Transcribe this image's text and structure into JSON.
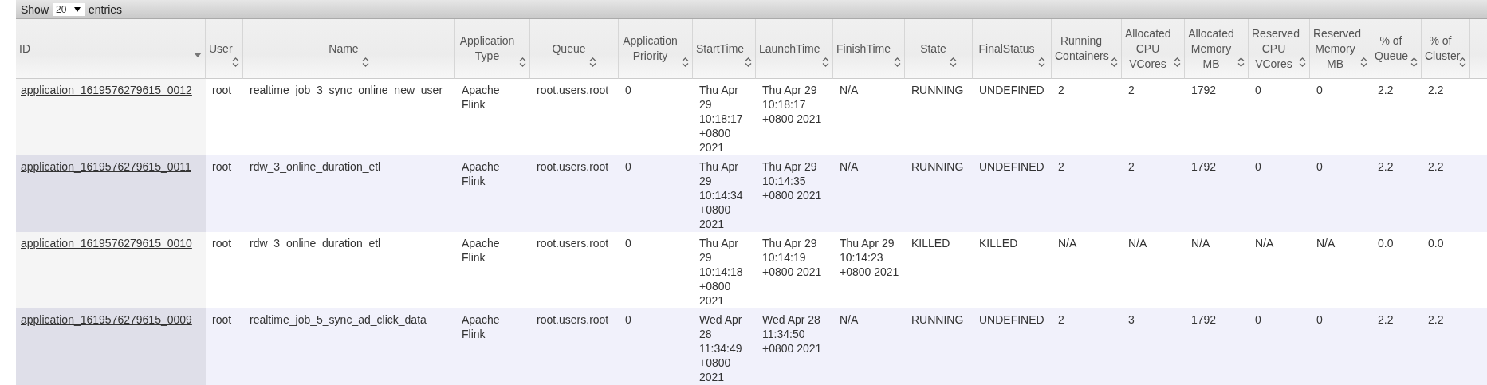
{
  "toolbar": {
    "show_label": "Show",
    "page_size": "20",
    "entries_label": "entries"
  },
  "columns": [
    {
      "label": "ID",
      "sorted_descending": true
    },
    {
      "label": "User",
      "sorted_descending": false
    },
    {
      "label": "Name",
      "sorted_descending": false
    },
    {
      "label": "Application Type",
      "sorted_descending": false
    },
    {
      "label": "Queue",
      "sorted_descending": false
    },
    {
      "label": "Application Priority",
      "sorted_descending": false
    },
    {
      "label": "StartTime",
      "sorted_descending": false
    },
    {
      "label": "LaunchTime",
      "sorted_descending": false
    },
    {
      "label": "FinishTime",
      "sorted_descending": false
    },
    {
      "label": "State",
      "sorted_descending": false
    },
    {
      "label": "FinalStatus",
      "sorted_descending": false
    },
    {
      "label": "Running Containers",
      "sorted_descending": false
    },
    {
      "label": "Allocated CPU VCores",
      "sorted_descending": false
    },
    {
      "label": "Allocated Memory MB",
      "sorted_descending": false
    },
    {
      "label": "Reserved CPU VCores",
      "sorted_descending": false
    },
    {
      "label": "Reserved Memory MB",
      "sorted_descending": false
    },
    {
      "label": "% of Queue",
      "sorted_descending": false
    },
    {
      "label": "% of Cluster",
      "sorted_descending": false
    }
  ],
  "rows": [
    {
      "cells": [
        "application_1619576279615_0012",
        "root",
        "realtime_job_3_sync_online_new_user",
        "Apache Flink",
        "root.users.root",
        "0",
        "Thu Apr 29 10:18:17 +0800 2021",
        "Thu Apr 29 10:18:17 +0800 2021",
        "N/A",
        "RUNNING",
        "UNDEFINED",
        "2",
        "2",
        "1792",
        "0",
        "0",
        "2.2",
        "2.2"
      ]
    },
    {
      "cells": [
        "application_1619576279615_0011",
        "root",
        "rdw_3_online_duration_etl",
        "Apache Flink",
        "root.users.root",
        "0",
        "Thu Apr 29 10:14:34 +0800 2021",
        "Thu Apr 29 10:14:35 +0800 2021",
        "N/A",
        "RUNNING",
        "UNDEFINED",
        "2",
        "2",
        "1792",
        "0",
        "0",
        "2.2",
        "2.2"
      ]
    },
    {
      "cells": [
        "application_1619576279615_0010",
        "root",
        "rdw_3_online_duration_etl",
        "Apache Flink",
        "root.users.root",
        "0",
        "Thu Apr 29 10:14:18 +0800 2021",
        "Thu Apr 29 10:14:19 +0800 2021",
        "Thu Apr 29 10:14:23 +0800 2021",
        "KILLED",
        "KILLED",
        "N/A",
        "N/A",
        "N/A",
        "N/A",
        "N/A",
        "0.0",
        "0.0"
      ]
    },
    {
      "cells": [
        "application_1619576279615_0009",
        "root",
        "realtime_job_5_sync_ad_click_data",
        "Apache Flink",
        "root.users.root",
        "0",
        "Wed Apr 28 11:34:49 +0800 2021",
        "Wed Apr 28 11:34:50 +0800 2021",
        "N/A",
        "RUNNING",
        "UNDEFINED",
        "2",
        "3",
        "1792",
        "0",
        "0",
        "2.2",
        "2.2"
      ]
    }
  ]
}
